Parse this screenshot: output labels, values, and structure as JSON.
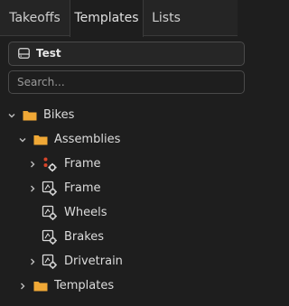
{
  "tabs": [
    {
      "label": "Takeoffs",
      "active": false
    },
    {
      "label": "Templates",
      "active": true
    },
    {
      "label": "Lists",
      "active": false
    }
  ],
  "project_selector": {
    "label": "Test",
    "icon": "drive-icon"
  },
  "search": {
    "placeholder": "Search..."
  },
  "tree": [
    {
      "label": "Bikes",
      "icon": "folder-icon",
      "expanded": true
    },
    {
      "label": "Assemblies",
      "icon": "folder-icon",
      "expanded": true
    },
    {
      "label": "Frame",
      "icon": "assembly-colored-gear-icon",
      "expanded": false
    },
    {
      "label": "Frame",
      "icon": "assembly-gear-icon",
      "expanded": false
    },
    {
      "label": "Wheels",
      "icon": "assembly-gear-icon"
    },
    {
      "label": "Brakes",
      "icon": "assembly-gear-icon"
    },
    {
      "label": "Drivetrain",
      "icon": "assembly-gear-icon",
      "expanded": false
    },
    {
      "label": "Templates",
      "icon": "folder-icon",
      "expanded": false
    }
  ],
  "colors": {
    "background": "#1e1e1e",
    "folder": "#f0a836",
    "accent_red": "#d9452a"
  }
}
